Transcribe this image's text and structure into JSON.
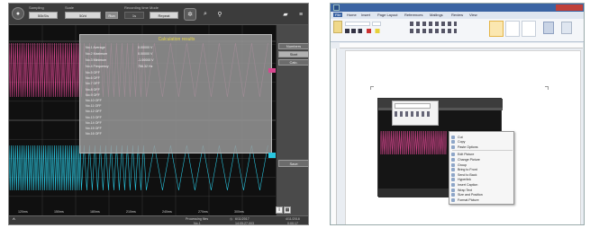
{
  "scope": {
    "header": {
      "col1_label": "Sampling",
      "col1_value": "50kS/s",
      "col2_label": "Scale",
      "col2_value": "50/d",
      "col3_label": "Recording time",
      "col3_value": "1s",
      "col4_label": "Mode",
      "col4_value": "Repeat",
      "run_label": "Run"
    },
    "icons": {
      "settings": "gear-icon",
      "zoom": "magnifier-icon",
      "marker": "pin-icon",
      "folder": "folder-icon",
      "menu": "menu-icon"
    },
    "calc": {
      "title": "Calculation results",
      "rows": [
        {
          "label": "No.1",
          "name": "Average",
          "value": "0.00000",
          "unit": "V"
        },
        {
          "label": "No.2",
          "name": "Maximum",
          "value": "0.00000",
          "unit": "V"
        },
        {
          "label": "No.3",
          "name": "Minimum",
          "value": "-1.00000",
          "unit": "V"
        },
        {
          "label": "No.4",
          "name": "Frequency",
          "value": "756.32",
          "unit": "Hz"
        }
      ],
      "off_labels": [
        "No.5",
        "No.6",
        "No.7",
        "No.8",
        "No.9",
        "No.10",
        "No.11",
        "No.12",
        "No.13",
        "No.14",
        "No.15",
        "No.16"
      ],
      "off_value": "OFF"
    },
    "side_buttons": [
      "Numbers",
      "Start",
      "Calc."
    ],
    "side_lower": [
      "Save"
    ],
    "axis_ticks": [
      "120ms",
      "150ms",
      "180ms",
      "210ms",
      "240ms",
      "270ms",
      "300ms"
    ],
    "status": {
      "processing": "Processing files",
      "proc_sub": "No.1",
      "date": "6/11/2017",
      "time": "14:05:27.003",
      "right_a": "4/11/2018",
      "right_b": "0:00:17"
    },
    "colors": {
      "ch1": "#d8468f",
      "ch2": "#29c6e0",
      "bg": "#1d1d1d"
    }
  },
  "word": {
    "tabs": [
      "File",
      "Home",
      "Insert",
      "Page Layout",
      "References",
      "Mailings",
      "Review",
      "View"
    ],
    "ctx_items": [
      "Cut",
      "Copy",
      "Paste Options",
      "",
      "Edit Picture",
      "Change Picture",
      "Group",
      "Bring to Front",
      "Send to Back",
      "Hyperlink",
      "Insert Caption",
      "Wrap Text",
      "Size and Position",
      "Format Picture"
    ]
  }
}
